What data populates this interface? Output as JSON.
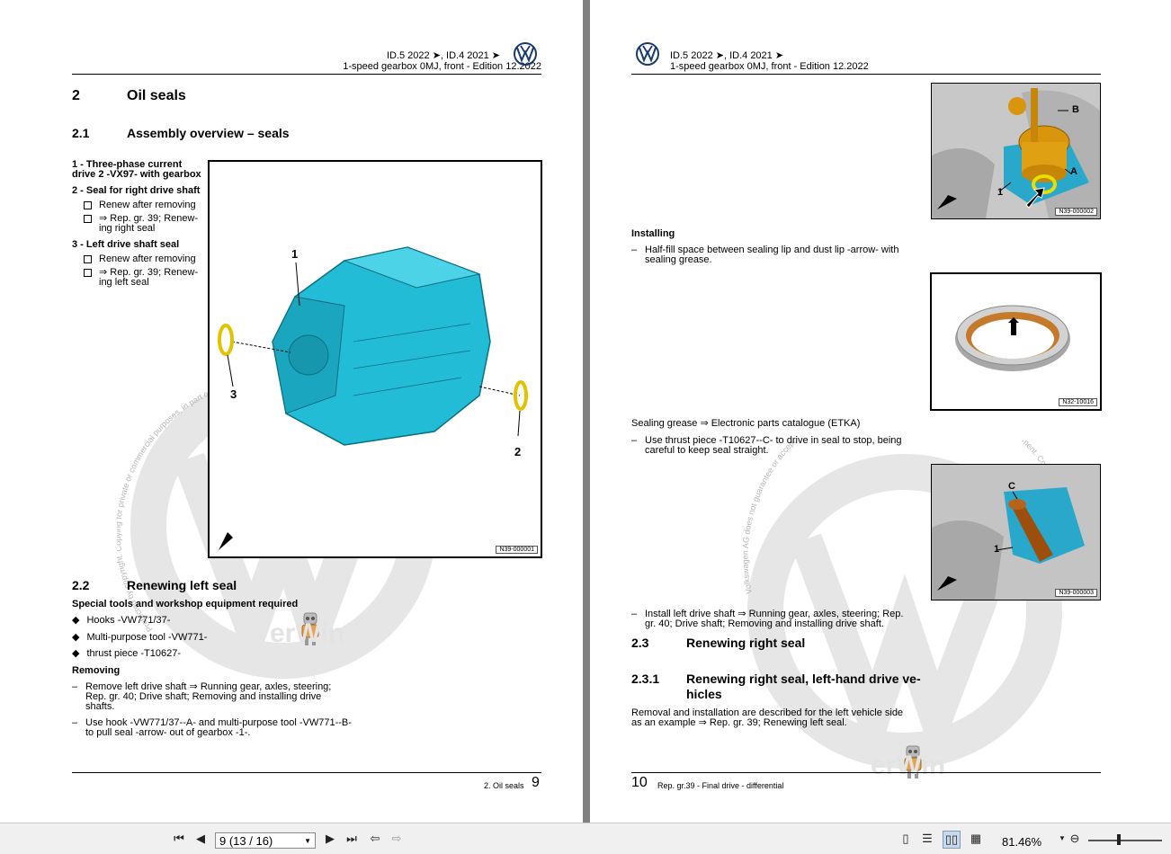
{
  "left_page": {
    "header": {
      "line1": "ID.5 2022 ➤, ID.4 2021 ➤",
      "line2": "1-speed gearbox 0MJ, front - Edition 12.2022"
    },
    "section": {
      "number": "2",
      "title": "Oil seals"
    },
    "subsection1": {
      "number": "2.1",
      "title": "Assembly overview – seals"
    },
    "legend": [
      {
        "title_line1": "1 - Three-phase current",
        "title_line2": "drive 2 -VX97- with gearbox"
      },
      {
        "title": "2 - Seal for right drive shaft",
        "bullets": [
          {
            "l1": "Renew after removing",
            "l2": ""
          },
          {
            "l1": "⇒ Rep. gr. 39; Renew-",
            "l2": "ing right seal"
          }
        ]
      },
      {
        "title": "3 - Left drive shaft seal",
        "bullets": [
          {
            "l1": "Renew after removing",
            "l2": ""
          },
          {
            "l1": "⇒ Rep. gr. 39; Renew-",
            "l2": "ing left seal"
          }
        ]
      }
    ],
    "figure": {
      "code": "N39-000001",
      "callouts": [
        "1",
        "2",
        "3"
      ]
    },
    "subsection2": {
      "number": "2.2",
      "title": "Renewing left seal"
    },
    "tools_heading": "Special tools and workshop equipment required",
    "tools": [
      "Hooks -VW771/37-",
      "Multi-purpose tool -VW771-",
      "thrust piece -T10627-"
    ],
    "removing_heading": "Removing",
    "steps": [
      {
        "l1": "Remove left drive shaft ⇒ Running gear, axles, steering;",
        "l2": "Rep. gr. 40; Drive shaft; Removing and installing drive",
        "l3": "shafts."
      },
      {
        "l1": "Use hook -VW771/37--A- and multi-purpose tool -VW771--B-",
        "l2": "to pull seal -arrow- out of gearbox -1-.",
        "l3": ""
      }
    ],
    "footer": {
      "label": "2. Oil seals",
      "page": "9"
    }
  },
  "right_page": {
    "header": {
      "line1": "ID.5 2022 ➤, ID.4 2021 ➤",
      "line2": "1-speed gearbox 0MJ, front - Edition 12.2022"
    },
    "figure1": {
      "code": "N39-000002",
      "callouts": [
        "A",
        "B",
        "1"
      ]
    },
    "installing_heading": "Installing",
    "install_step1": {
      "l1": "Half-fill space between sealing lip and dust lip -arrow- with",
      "l2": "sealing grease."
    },
    "figure2": {
      "code": "N32-10016"
    },
    "grease_note": "Sealing grease ⇒ Electronic parts catalogue (ETKA)",
    "install_step2": {
      "l1": "Use thrust piece -T10627--C- to drive in seal to stop, being",
      "l2": "careful to keep seal straight."
    },
    "figure3": {
      "code": "N39-000003",
      "callouts": [
        "C",
        "1"
      ]
    },
    "install_step3": {
      "l1": "Install left drive shaft ⇒ Running gear, axles, steering; Rep.",
      "l2": "gr. 40; Drive shaft; Removing and installing drive shaft."
    },
    "subsection3": {
      "number": "2.3",
      "title": "Renewing right seal"
    },
    "subsection4": {
      "number": "2.3.1",
      "title_l1": "Renewing right seal, left-hand drive ve-",
      "title_l2": "hicles"
    },
    "note": {
      "l1": "Removal and installation are described for the left vehicle side",
      "l2": "as an example ⇒ Rep. gr. 39; Renewing left seal."
    },
    "footer": {
      "page": "10",
      "label": "Rep. gr.39 - Final drive - differential"
    }
  },
  "watermark": {
    "left_arc": "Protected by copyright. Copying for private or commercial purposes, in part or in whole, is not permitted unless authorised by Volkswagen AG",
    "right_arc": "Volkswagen AG does not guarantee or accept any liability with respect to the correctness of information in this document. Copyright by Volkswagen AG.",
    "brand": "erWin"
  },
  "toolbar": {
    "page_indicator": "9 (13 / 16)",
    "zoom": "81.46%"
  }
}
